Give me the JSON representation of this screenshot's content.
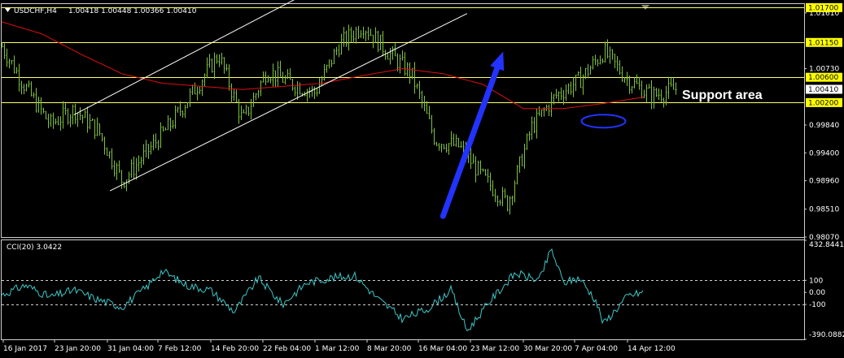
{
  "header": {
    "symbol_label": "USDCHF,H4",
    "ohlc_label": "1.00418 1.00448 1.00366 1.00410"
  },
  "annotation": {
    "support_label": "Support area"
  },
  "indicator": {
    "label": "CCI(20) 3.0422"
  },
  "colors": {
    "background": "#000000",
    "candles": "#7fbf3f",
    "moving_average": "#e01010",
    "levels": "#ffff66",
    "channel": "#ffffff",
    "arrow": "#2233ff",
    "ellipse": "#2233ff",
    "cci": "#3ec6c6",
    "axis_text": "#ffffff",
    "level_label_bg": "#ffff00"
  },
  "chart_data": [
    {
      "type": "candlestick",
      "title": "USDCHF,H4",
      "ylim": [
        0.9807,
        1.0175
      ],
      "y_ticks": [
        "1.01610",
        "1.00730",
        "0.99840",
        "0.99400",
        "0.98960",
        "0.98510",
        "0.98070"
      ],
      "x_ticks": [
        "16 Jan 2017",
        "23 Jan 20:00",
        "31 Jan 04:00",
        "7 Feb 12:00",
        "14 Feb 20:00",
        "22 Feb 04:00",
        "1 Mar 12:00",
        "8 Mar 20:00",
        "16 Mar 04:00",
        "23 Mar 12:00",
        "30 Mar 20:00",
        "7 Apr 04:00",
        "14 Apr 12:00"
      ],
      "horizontal_levels": [
        {
          "label": "1.01700",
          "value": 1.017
        },
        {
          "label": "1.01150",
          "value": 1.0115
        },
        {
          "label": "1.00600",
          "value": 1.006
        },
        {
          "label": "1.00200",
          "value": 1.002
        }
      ],
      "current_price": {
        "label": "1.00410",
        "value": 1.0041
      },
      "price_path": [
        {
          "x": 0.0,
          "y": 1.0108
        },
        {
          "x": 0.03,
          "y": 1.0042
        },
        {
          "x": 0.06,
          "y": 0.9985
        },
        {
          "x": 0.09,
          "y": 1.0008
        },
        {
          "x": 0.12,
          "y": 0.9975
        },
        {
          "x": 0.15,
          "y": 0.9895
        },
        {
          "x": 0.18,
          "y": 0.994
        },
        {
          "x": 0.21,
          "y": 0.9985
        },
        {
          "x": 0.24,
          "y": 1.004
        },
        {
          "x": 0.27,
          "y": 1.0095
        },
        {
          "x": 0.3,
          "y": 0.999
        },
        {
          "x": 0.33,
          "y": 1.007
        },
        {
          "x": 0.36,
          "y": 1.005
        },
        {
          "x": 0.39,
          "y": 1.0035
        },
        {
          "x": 0.42,
          "y": 1.011
        },
        {
          "x": 0.45,
          "y": 1.0142
        },
        {
          "x": 0.48,
          "y": 1.01
        },
        {
          "x": 0.51,
          "y": 1.0065
        },
        {
          "x": 0.54,
          "y": 0.996
        },
        {
          "x": 0.57,
          "y": 0.995
        },
        {
          "x": 0.6,
          "y": 0.99
        },
        {
          "x": 0.63,
          "y": 0.986
        },
        {
          "x": 0.66,
          "y": 0.998
        },
        {
          "x": 0.69,
          "y": 1.003
        },
        {
          "x": 0.72,
          "y": 1.0055
        },
        {
          "x": 0.75,
          "y": 1.01
        },
        {
          "x": 0.78,
          "y": 1.0055
        },
        {
          "x": 0.81,
          "y": 1.003
        },
        {
          "x": 0.84,
          "y": 1.0041
        }
      ],
      "moving_average_path": [
        {
          "x": 0.0,
          "y": 1.0147
        },
        {
          "x": 0.05,
          "y": 1.0128
        },
        {
          "x": 0.1,
          "y": 1.0095
        },
        {
          "x": 0.15,
          "y": 1.0065
        },
        {
          "x": 0.2,
          "y": 1.005
        },
        {
          "x": 0.25,
          "y": 1.0045
        },
        {
          "x": 0.3,
          "y": 1.004
        },
        {
          "x": 0.35,
          "y": 1.0045
        },
        {
          "x": 0.4,
          "y": 1.005
        },
        {
          "x": 0.45,
          "y": 1.0062
        },
        {
          "x": 0.5,
          "y": 1.0073
        },
        {
          "x": 0.55,
          "y": 1.0065
        },
        {
          "x": 0.6,
          "y": 1.0048
        },
        {
          "x": 0.65,
          "y": 1.001
        },
        {
          "x": 0.7,
          "y": 1.001
        },
        {
          "x": 0.75,
          "y": 1.0018
        },
        {
          "x": 0.8,
          "y": 1.0028
        }
      ],
      "channel_lines": [
        {
          "x1": 0.09,
          "y1": 1.0,
          "x2": 0.38,
          "y2": 1.0192
        },
        {
          "x1": 0.135,
          "y1": 0.988,
          "x2": 0.58,
          "y2": 1.016
        }
      ],
      "arrow": {
        "x1": 0.55,
        "y1": 0.984,
        "x2": 0.625,
        "y2": 1.01
      },
      "support_ellipse": {
        "cx": 0.75,
        "cy": 0.999
      }
    },
    {
      "type": "line",
      "title": "CCI(20) 3.0422",
      "ylim": [
        -390.0882,
        432.8441
      ],
      "y_ticks": [
        "432.8441",
        "100",
        "0.00",
        "-100",
        "-390.0882"
      ],
      "reference_lines": [
        100,
        -100
      ],
      "cci_path": [
        {
          "x": 0.0,
          "y": -20
        },
        {
          "x": 0.03,
          "y": 60
        },
        {
          "x": 0.06,
          "y": -40
        },
        {
          "x": 0.09,
          "y": 20
        },
        {
          "x": 0.12,
          "y": -60
        },
        {
          "x": 0.15,
          "y": -120
        },
        {
          "x": 0.18,
          "y": 40
        },
        {
          "x": 0.2,
          "y": 180
        },
        {
          "x": 0.23,
          "y": 60
        },
        {
          "x": 0.26,
          "y": 20
        },
        {
          "x": 0.29,
          "y": -160
        },
        {
          "x": 0.32,
          "y": 120
        },
        {
          "x": 0.35,
          "y": -100
        },
        {
          "x": 0.38,
          "y": 80
        },
        {
          "x": 0.41,
          "y": 120
        },
        {
          "x": 0.44,
          "y": 140
        },
        {
          "x": 0.47,
          "y": -60
        },
        {
          "x": 0.5,
          "y": -220
        },
        {
          "x": 0.53,
          "y": -140
        },
        {
          "x": 0.56,
          "y": 20
        },
        {
          "x": 0.58,
          "y": -320
        },
        {
          "x": 0.61,
          "y": -60
        },
        {
          "x": 0.64,
          "y": 160
        },
        {
          "x": 0.67,
          "y": 100
        },
        {
          "x": 0.685,
          "y": 360
        },
        {
          "x": 0.7,
          "y": 80
        },
        {
          "x": 0.72,
          "y": 120
        },
        {
          "x": 0.74,
          "y": -60
        },
        {
          "x": 0.75,
          "y": -260
        },
        {
          "x": 0.78,
          "y": -30
        },
        {
          "x": 0.8,
          "y": 3
        }
      ]
    }
  ]
}
